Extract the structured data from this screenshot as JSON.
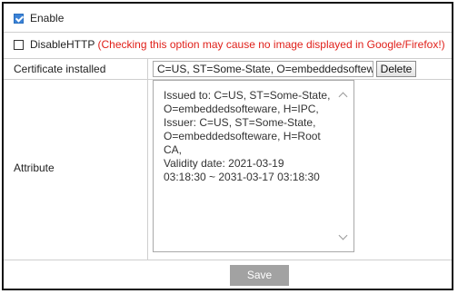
{
  "enable": {
    "label": "Enable",
    "checked": true
  },
  "disable_http": {
    "label": "DisableHTTP",
    "warning": "(Checking this option may cause no image displayed in Google/Firefox!)",
    "checked": false
  },
  "certificate": {
    "label": "Certificate installed",
    "value": "C=US, ST=Some-State, O=embeddedsoftewa",
    "delete_label": "Delete"
  },
  "attribute": {
    "label": "Attribute",
    "lines": [
      "Issued to: C=US, ST=Some-State,",
      "O=embeddedsofteware, H=IPC,",
      "Issuer: C=US, ST=Some-State,",
      "O=embeddedsofteware, H=Root",
      "CA,",
      "Validity date: 2021-03-19",
      "03:18:30 ~ 2031-03-17 03:18:30"
    ]
  },
  "save_label": "Save",
  "colors": {
    "warning": "#e0201a",
    "checkbox": "#3b82d6",
    "save_button": "#a2a2a2"
  }
}
